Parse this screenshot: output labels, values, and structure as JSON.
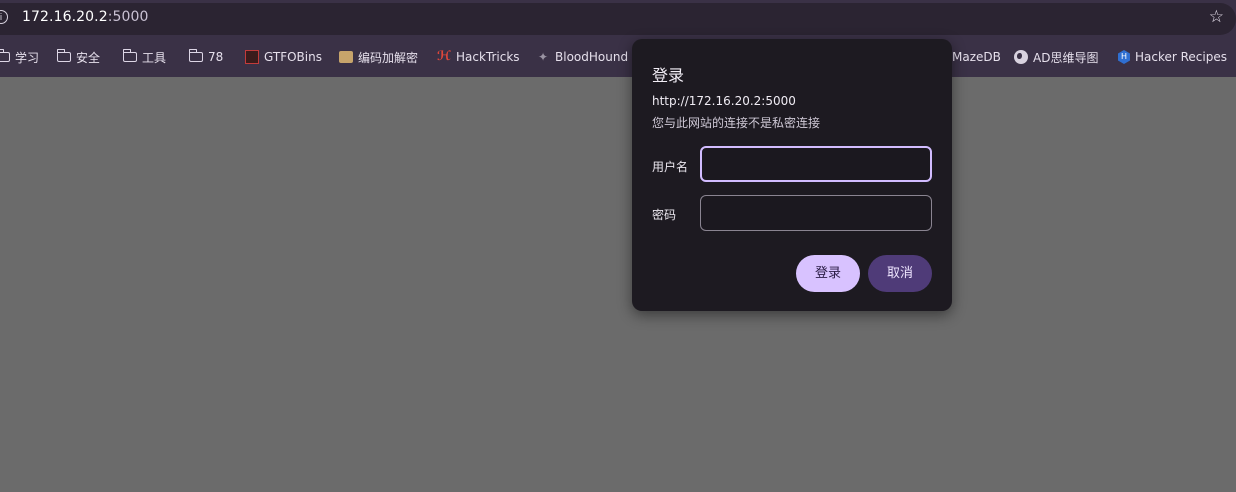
{
  "browser": {
    "url_host": "172.16.20.2",
    "url_port": ":5000",
    "site_info_icon": "info-icon",
    "bookmark_star_icon": "star-icon"
  },
  "bookmarks": [
    {
      "label": "学习",
      "icon": "folder-icon"
    },
    {
      "label": "安全",
      "icon": "folder-icon"
    },
    {
      "label": "工具",
      "icon": "folder-icon"
    },
    {
      "label": "78",
      "icon": "folder-icon"
    },
    {
      "label": "GTFOBins",
      "icon": "gtfobins-icon"
    },
    {
      "label": "编码加解密",
      "icon": "package-icon"
    },
    {
      "label": "HackTricks",
      "icon": "hacktricks-icon"
    },
    {
      "label": "BloodHound",
      "icon": "bloodhound-icon"
    },
    {
      "label": "MazeDB",
      "icon": ""
    },
    {
      "label": "AD思维导图",
      "icon": "globe-icon"
    },
    {
      "label": "Hacker Recipes",
      "icon": "hacker-recipes-icon"
    }
  ],
  "dialog": {
    "title": "登录",
    "url": "http://172.16.20.2:5000",
    "note": "您与此网站的连接不是私密连接",
    "username_label": "用户名",
    "username_value": "",
    "password_label": "密码",
    "password_value": "",
    "login_button": "登录",
    "cancel_button": "取消"
  },
  "colors": {
    "page_bg": "#6b6b6b",
    "toolbar_bg": "#3a3146",
    "dialog_bg": "#1d1a21",
    "primary_button": "#d8c2ff",
    "secondary_button": "#4f3b78"
  }
}
